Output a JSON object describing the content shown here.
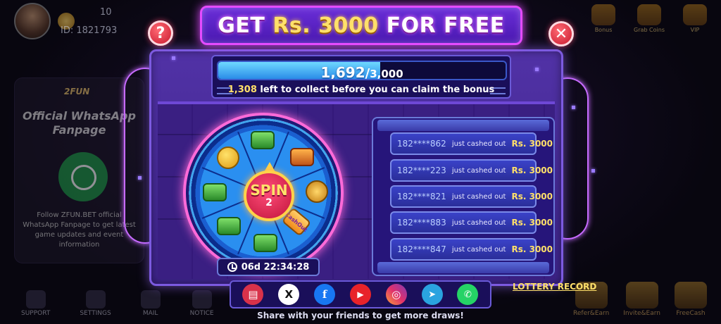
{
  "header": {
    "title_prefix": "GET ",
    "title_amount": "Rs. 3000",
    "title_suffix": " FOR FREE"
  },
  "background": {
    "user_id": "ID: 1821793",
    "coins": "10",
    "promo_brand": "2FUN",
    "promo_title": "Official WhatsApp Fanpage",
    "promo_text": "Follow ZFUN.BET official WhatsApp Fanpage to get latest game updates and event information",
    "top_right": [
      {
        "label": "Bonus"
      },
      {
        "label": "Grab Coins"
      },
      {
        "label": "VIP"
      }
    ],
    "bottom_nav": [
      {
        "label": "SUPPORT"
      },
      {
        "label": "SETTINGS"
      },
      {
        "label": "MAIL"
      },
      {
        "label": "NOTICE"
      }
    ],
    "bottom_right": [
      {
        "label": "Refer&Earn"
      },
      {
        "label": "Invite&Earn"
      },
      {
        "label": "FreeCash"
      }
    ]
  },
  "progress": {
    "current": "1,692",
    "separator": "/",
    "total": "3,000",
    "fraction": 0.564,
    "remaining": "1,308",
    "note": " left to collect before you can claim the bonus"
  },
  "wheel": {
    "spin_label": "SPIN",
    "spin_count": "2",
    "tag_text": "CashOut",
    "icons": [
      "cash-icon",
      "chest-icon",
      "coin-icon",
      "tag-icon",
      "cash-icon",
      "cash-icon",
      "cash-icon",
      "emoji-icon"
    ]
  },
  "timer": {
    "value": "06d 22:34:28"
  },
  "cashouts": [
    {
      "phone": "182****862",
      "text": "just cashed out",
      "amount": "Rs. 3000"
    },
    {
      "phone": "182****223",
      "text": "just cashed out",
      "amount": "Rs. 3000"
    },
    {
      "phone": "182****821",
      "text": "just cashed out",
      "amount": "Rs. 3000"
    },
    {
      "phone": "182****883",
      "text": "just cashed out",
      "amount": "Rs. 3000"
    },
    {
      "phone": "182****847",
      "text": "just cashed out",
      "amount": "Rs. 3000"
    }
  ],
  "share": {
    "buttons": [
      {
        "name": "message-icon",
        "glyph": "▤"
      },
      {
        "name": "x-icon",
        "glyph": "X"
      },
      {
        "name": "facebook-icon",
        "glyph": "f"
      },
      {
        "name": "youtube-icon",
        "glyph": "▶"
      },
      {
        "name": "instagram-icon",
        "glyph": "◎"
      },
      {
        "name": "telegram-icon",
        "glyph": "➤"
      },
      {
        "name": "whatsapp-icon",
        "glyph": "✆"
      }
    ],
    "caption": "Share with your friends to get more draws!"
  },
  "lottery_record": "LOTTERY RECORD",
  "buttons": {
    "help": "?",
    "close": "✕"
  },
  "colors": {
    "accent_pink": "#e44bff",
    "amount_gold": "#ffe06a",
    "progress_blue": "#2a8ce8"
  }
}
